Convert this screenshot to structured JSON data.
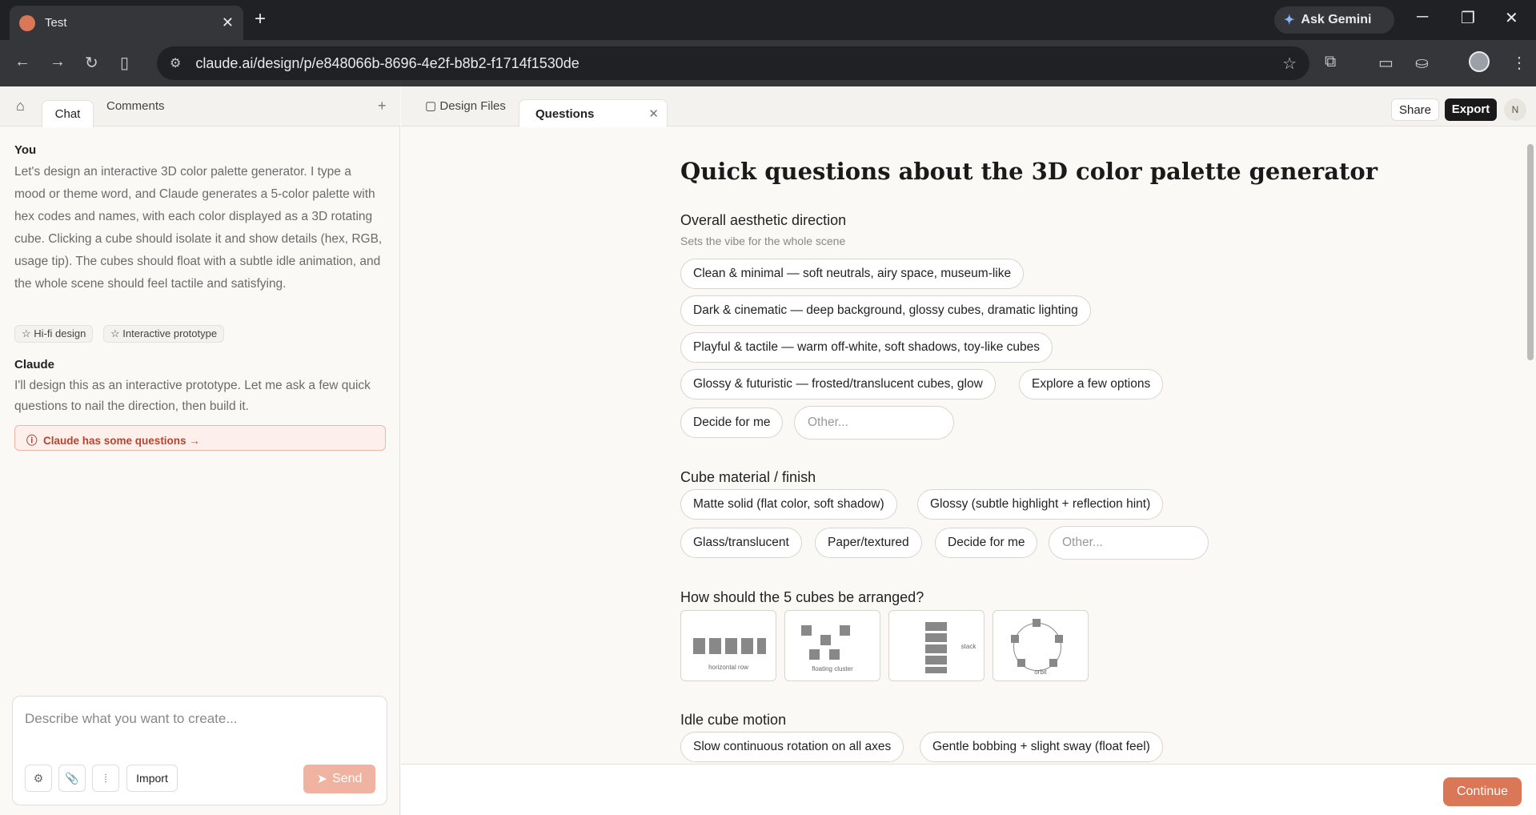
{
  "browser": {
    "tab_title": "Test",
    "url": "claude.ai/design/p/e848066b-8696-4e2f-b8b2-f1714f1530de",
    "gemini_label": "Ask Gemini"
  },
  "left_panel": {
    "tabs": [
      "Chat",
      "Comments"
    ],
    "you_label": "You",
    "user_message": "Let's design an interactive 3D color palette generator. I type a mood or theme word, and Claude generates a 5-color palette with hex codes and names, with each color displayed as a 3D rotating cube. Clicking a cube should isolate it and show details (hex, RGB, usage tip). The cubes should float with a subtle idle animation, and the whole scene should feel tactile and satisfying.",
    "chips": [
      "Hi-fi design",
      "Interactive prototype"
    ],
    "claude_label": "Claude",
    "claude_message": "I'll design this as an interactive prototype. Let me ask a few quick questions to nail the direction, then build it.",
    "questions_link": "Claude has some questions →",
    "input_placeholder": "Describe what you want to create...",
    "import_label": "Import",
    "send_label": "Send"
  },
  "right_panel": {
    "tabs": [
      "Design Files",
      "Questions"
    ],
    "share_label": "Share",
    "export_label": "Export",
    "avatar_initial": "N",
    "title": "Quick questions about the 3D color palette generator",
    "q1": {
      "title": "Overall aesthetic direction",
      "subtitle": "Sets the vibe for the whole scene",
      "options": [
        "Clean & minimal — soft neutrals, airy space, museum-like",
        "Dark & cinematic — deep background, glossy cubes, dramatic lighting",
        "Playful & tactile — warm off-white, soft shadows, toy-like cubes",
        "Glossy & futuristic — frosted/translucent cubes, glow",
        "Explore a few options",
        "Decide for me"
      ],
      "other_placeholder": "Other..."
    },
    "q2": {
      "title": "Cube material / finish",
      "options": [
        "Matte solid (flat color, soft shadow)",
        "Glossy (subtle highlight + reflection hint)",
        "Glass/translucent",
        "Paper/textured",
        "Decide for me"
      ],
      "other_placeholder": "Other..."
    },
    "q3": {
      "title": "How should the 5 cubes be arranged?",
      "options": [
        "horizontal row",
        "floating cluster",
        "stack",
        "orbit"
      ]
    },
    "q4": {
      "title": "Idle cube motion",
      "options": [
        "Slow continuous rotation on all axes",
        "Gentle bobbing + slight sway (float feel)"
      ]
    },
    "continue_label": "Continue"
  }
}
